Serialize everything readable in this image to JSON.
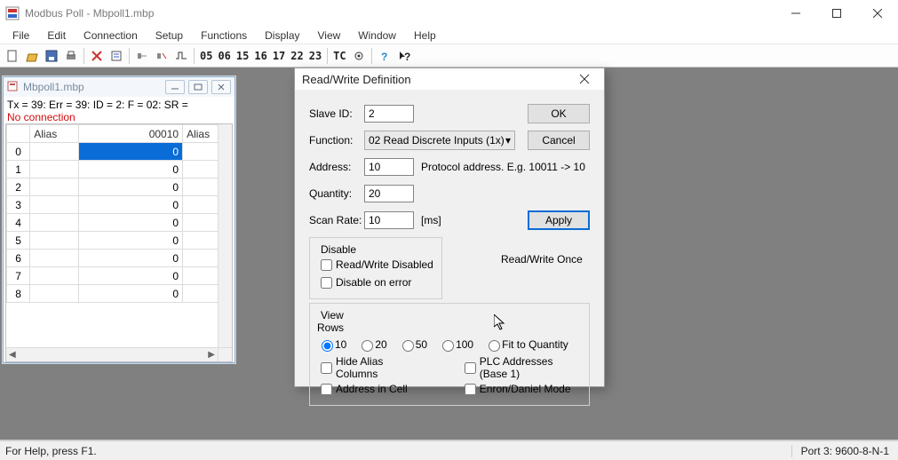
{
  "window": {
    "title": "Modbus Poll - Mbpoll1.mbp",
    "menus": [
      "File",
      "Edit",
      "Connection",
      "Setup",
      "Functions",
      "Display",
      "View",
      "Window",
      "Help"
    ],
    "tool_codes": [
      "05",
      "06",
      "15",
      "16",
      "17",
      "22",
      "23",
      "TC"
    ]
  },
  "statusbar": {
    "left": "For Help, press F1.",
    "right": "Port 3: 9600-8-N-1"
  },
  "child": {
    "title": "Mbpoll1.mbp",
    "status1": "Tx = 39: Err = 39: ID = 2: F = 02: SR =",
    "status2": "No connection",
    "headers": {
      "rownum": "",
      "alias": "Alias",
      "val": "00010",
      "alias2": "Alias"
    },
    "rows": [
      {
        "n": "0",
        "alias": "",
        "val": "0",
        "alias2": ""
      },
      {
        "n": "1",
        "alias": "",
        "val": "0",
        "alias2": ""
      },
      {
        "n": "2",
        "alias": "",
        "val": "0",
        "alias2": ""
      },
      {
        "n": "3",
        "alias": "",
        "val": "0",
        "alias2": ""
      },
      {
        "n": "4",
        "alias": "",
        "val": "0",
        "alias2": ""
      },
      {
        "n": "5",
        "alias": "",
        "val": "0",
        "alias2": ""
      },
      {
        "n": "6",
        "alias": "",
        "val": "0",
        "alias2": ""
      },
      {
        "n": "7",
        "alias": "",
        "val": "0",
        "alias2": ""
      },
      {
        "n": "8",
        "alias": "",
        "val": "0",
        "alias2": ""
      }
    ]
  },
  "dialog": {
    "title": "Read/Write Definition",
    "labels": {
      "slave_id": "Slave ID:",
      "function": "Function:",
      "address": "Address:",
      "quantity": "Quantity:",
      "scan_rate": "Scan Rate:",
      "ms": "[ms]",
      "proto_hint": "Protocol address. E.g. 10011 -> 10"
    },
    "buttons": {
      "ok": "OK",
      "cancel": "Cancel",
      "apply": "Apply",
      "rw_once": "Read/Write Once"
    },
    "values": {
      "slave_id": "2",
      "function_selected": "02 Read Discrete Inputs (1x)",
      "address": "10",
      "quantity": "20",
      "scan_rate": "10"
    },
    "disable_group": {
      "legend": "Disable",
      "rw_disabled": "Read/Write Disabled",
      "disable_on_error": "Disable on error"
    },
    "view_group": {
      "legend": "View",
      "rows_legend": "Rows",
      "radio_options": [
        "10",
        "20",
        "50",
        "100",
        "Fit to Quantity"
      ],
      "radio_selected": "10",
      "cb_hide_alias": "Hide Alias Columns",
      "cb_addr_in_cell": "Address in Cell",
      "cb_plc_base1": "PLC Addresses (Base 1)",
      "cb_enron": "Enron/Daniel Mode"
    }
  }
}
